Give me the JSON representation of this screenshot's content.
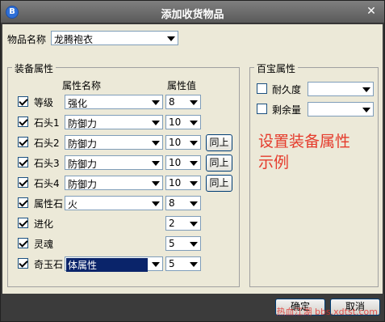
{
  "window": {
    "title": "添加收货物品",
    "app_icon": "B"
  },
  "item_name": {
    "label": "物品名称",
    "value": "龙腾袍衣"
  },
  "equip_group": {
    "title": "装备属性",
    "col_attr_name": "属性名称",
    "col_attr_value": "属性值",
    "rows": [
      {
        "label": "等级",
        "checked": true,
        "attr": "强化",
        "value": "8",
        "same_label": ""
      },
      {
        "label": "石头1",
        "checked": true,
        "attr": "防御力",
        "value": "10",
        "same_label": ""
      },
      {
        "label": "石头2",
        "checked": true,
        "attr": "防御力",
        "value": "10",
        "same_label": "同上"
      },
      {
        "label": "石头3",
        "checked": true,
        "attr": "防御力",
        "value": "10",
        "same_label": "同上"
      },
      {
        "label": "石头4",
        "checked": true,
        "attr": "防御力",
        "value": "10",
        "same_label": "同上"
      },
      {
        "label": "属性石",
        "checked": true,
        "attr": "火",
        "value": "8",
        "same_label": ""
      },
      {
        "label": "进化",
        "checked": true,
        "attr": "",
        "value": "2",
        "same_label": ""
      },
      {
        "label": "灵魂",
        "checked": true,
        "attr": "",
        "value": "5",
        "same_label": ""
      },
      {
        "label": "奇玉石",
        "checked": true,
        "attr": "体属性",
        "value": "5",
        "same_label": ""
      }
    ]
  },
  "treasure_group": {
    "title": "百宝属性",
    "durability_label": "耐久度",
    "remaining_label": "剩余量",
    "durability_value": "",
    "remaining_value": ""
  },
  "annotation": {
    "line1": "设置装备属性",
    "line2": "示例"
  },
  "footer": {
    "ok_label": "确定",
    "cancel_label": "取消",
    "watermark": "热血江湖 bbs.xdtst.com"
  },
  "colors": {
    "annotation": "#e53b2c",
    "highlight": "#0a246a"
  }
}
